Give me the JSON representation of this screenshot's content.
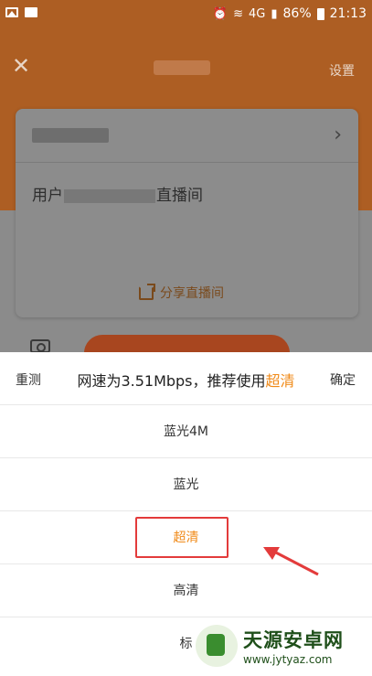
{
  "status_bar": {
    "battery": "86%",
    "time": "21:13",
    "signal_text": "4G"
  },
  "header": {
    "settings_label": "设置"
  },
  "card": {
    "room_prefix": "用户",
    "room_suffix": "直播间",
    "share_label": "分享直播间"
  },
  "sheet": {
    "reset_label": "重测",
    "confirm_label": "确定",
    "speed_prefix": "网速为3.51Mbps，推荐使用",
    "speed_recommend": "超清",
    "options": [
      "蓝光4M",
      "蓝光",
      "超清",
      "高清",
      "标"
    ]
  },
  "watermark": {
    "name": "天源安卓网",
    "url": "www.jytyaz.com"
  },
  "colors": {
    "accent": "#f08a18",
    "highlight_border": "#e33b3b"
  }
}
